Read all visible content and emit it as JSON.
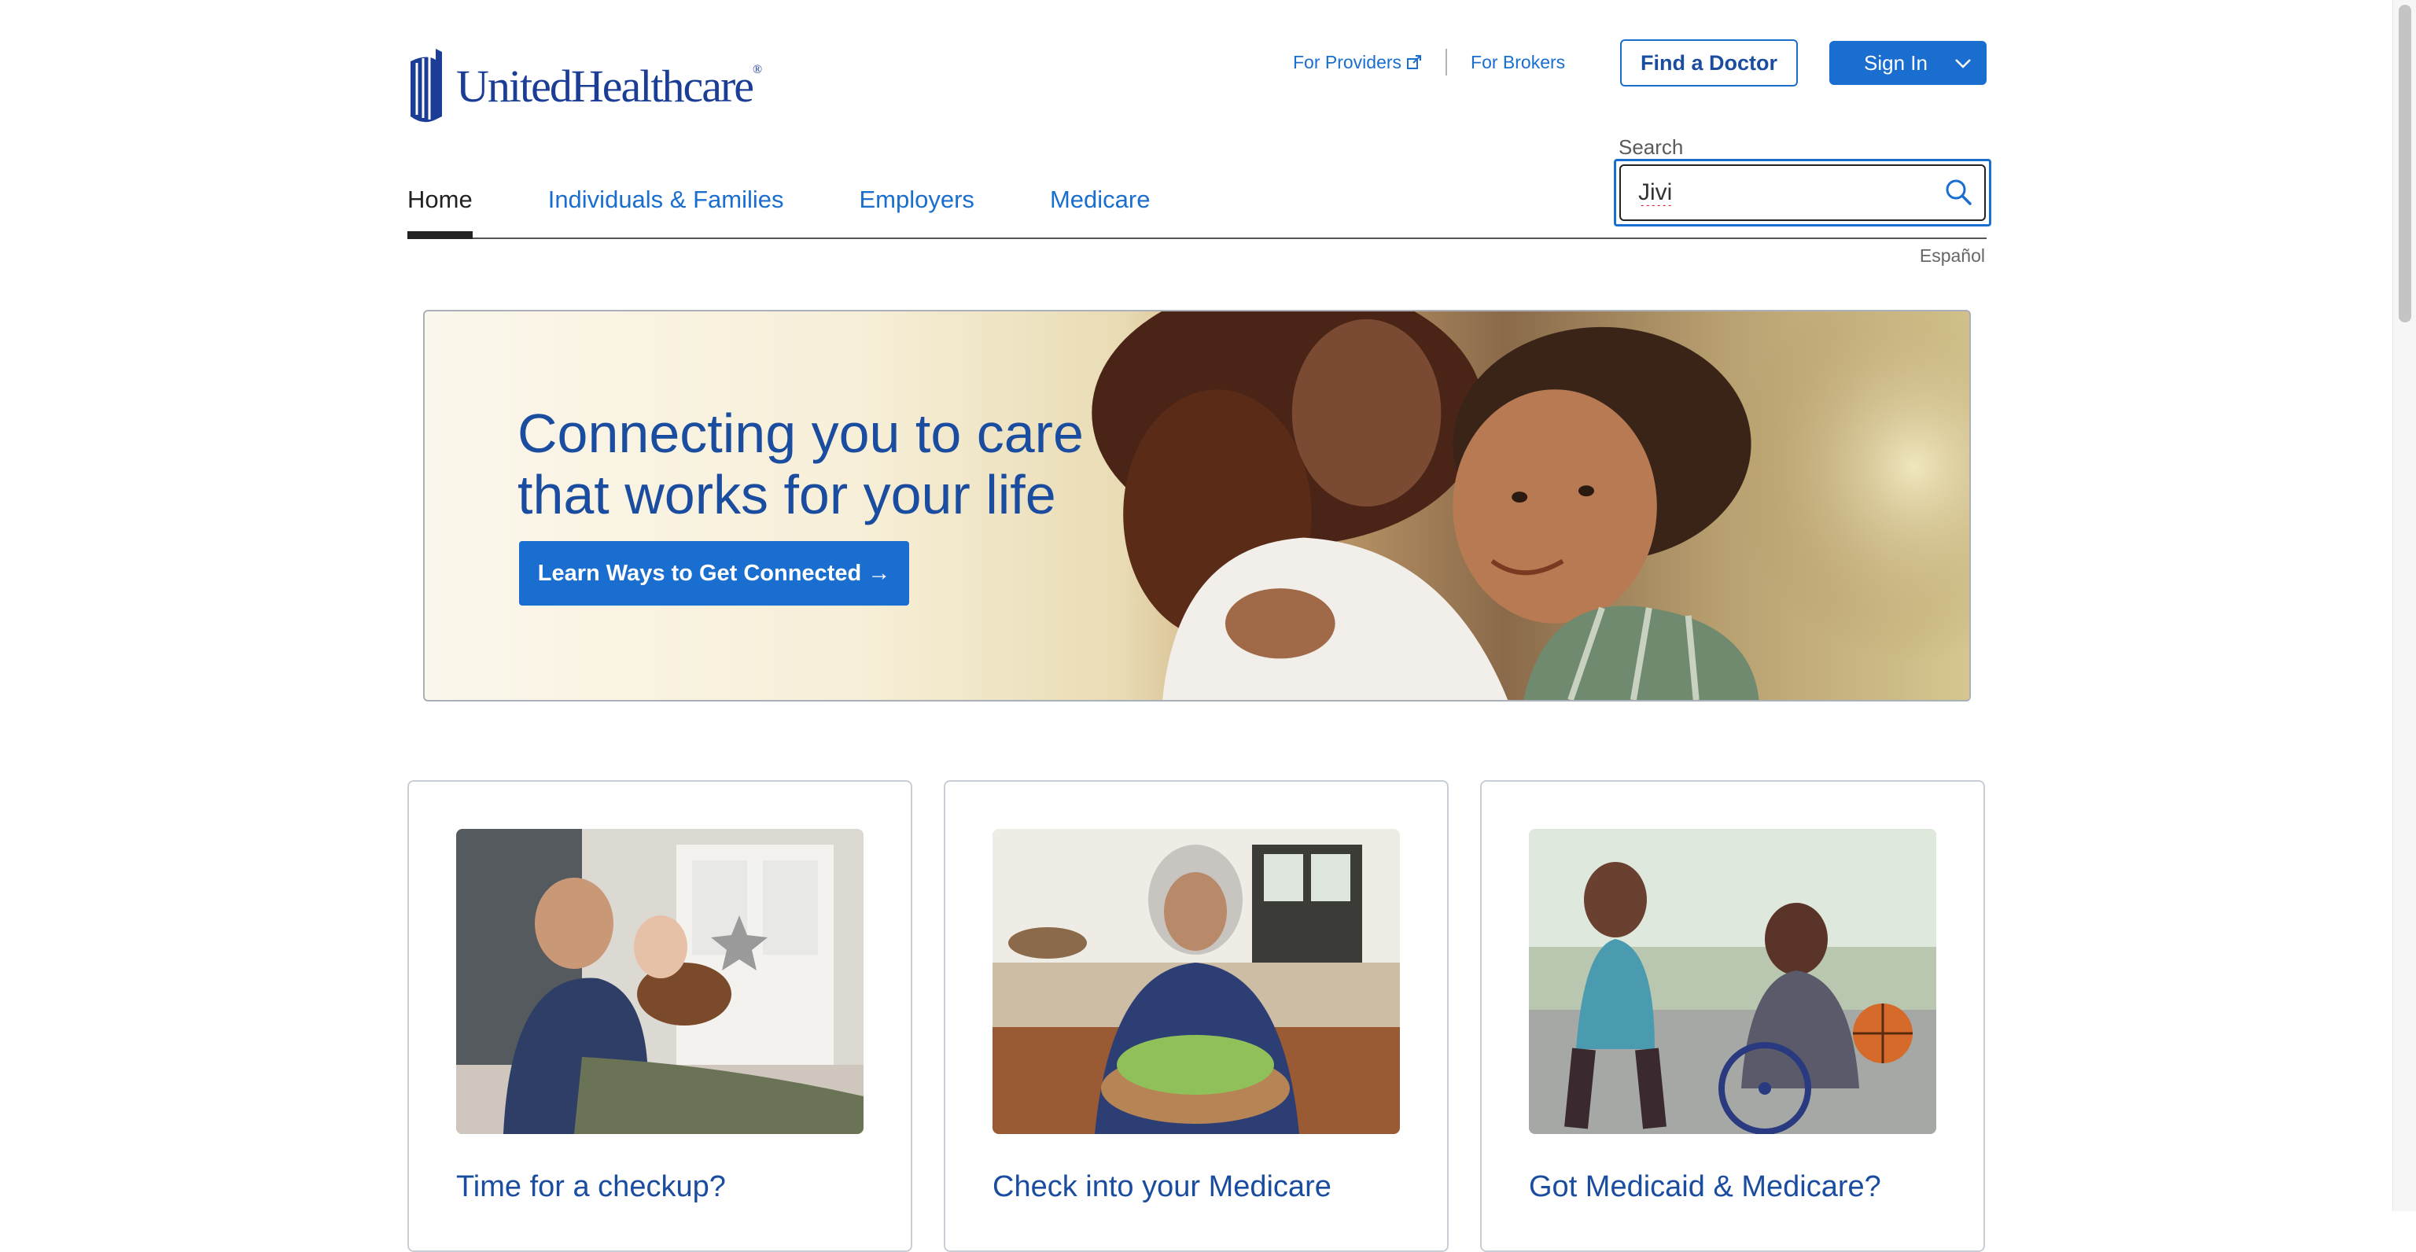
{
  "brand": {
    "name": "UnitedHealthcare",
    "reg": "®"
  },
  "utility": {
    "providers": "For Providers",
    "brokers": "For Brokers"
  },
  "header": {
    "find_doctor": "Find a Doctor",
    "sign_in": "Sign In"
  },
  "search": {
    "label": "Search",
    "value": "Jivi"
  },
  "nav": {
    "items": [
      {
        "label": "Home",
        "active": true
      },
      {
        "label": "Individuals & Families"
      },
      {
        "label": "Employers"
      },
      {
        "label": "Medicare"
      }
    ]
  },
  "language_link": "Español",
  "hero": {
    "title": "Connecting you to care that works for your life",
    "cta": "Learn Ways to Get Connected →"
  },
  "cards": [
    {
      "title": "Time for a checkup?"
    },
    {
      "title": "Check into your Medicare"
    },
    {
      "title": "Got Medicaid & Medicare?"
    }
  ],
  "colors": {
    "brand_blue": "#196ecf",
    "brand_navy": "#1a4c9f"
  },
  "icons": {
    "search": "search-icon",
    "external": "external-link-icon",
    "chevron": "chevron-down-icon"
  }
}
